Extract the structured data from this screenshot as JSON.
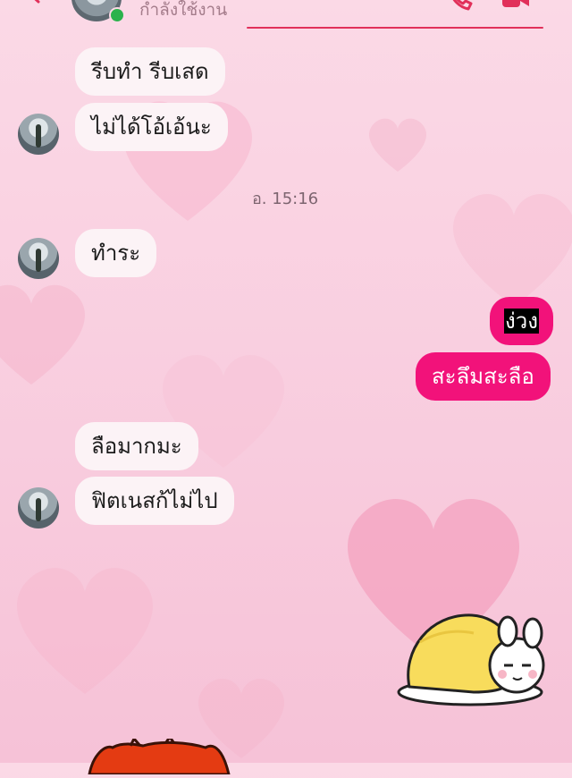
{
  "header": {
    "status_text": "กำลังใช้งาน",
    "status_color": "#2bb24c",
    "accent_color": "#e1305a"
  },
  "icons": {
    "back": "chevron-left-icon",
    "call": "phone-icon",
    "video": "video-camera-icon"
  },
  "messages": [
    {
      "side": "in",
      "text": "รีบทำ รีบเสด"
    },
    {
      "side": "in",
      "text": "ไม่ได้โอ้เอ้นะ"
    },
    {
      "side": "time",
      "text": "อ. 15:16"
    },
    {
      "side": "in",
      "text": "ทำระ"
    },
    {
      "side": "out",
      "text": "ง่วง"
    },
    {
      "side": "out",
      "text": "สะลึมสะลือ"
    },
    {
      "side": "in",
      "text": "ลือมากมะ"
    },
    {
      "side": "in",
      "text": "ฟิตเนสก้ไม่ไป"
    }
  ],
  "colors": {
    "outgoing_bubble": "#f2127a",
    "incoming_bubble": "#fcf3f6",
    "background": "#f9cfe0"
  }
}
